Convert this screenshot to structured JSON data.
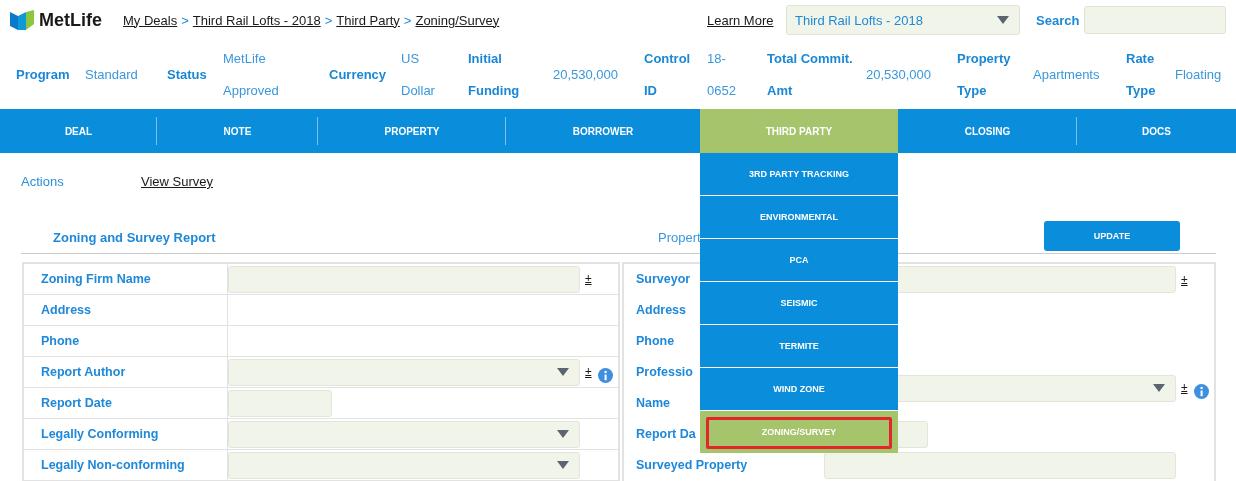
{
  "header": {
    "logo": "MetLife",
    "breadcrumb": [
      "My Deals",
      "Third Rail Lofts - 2018",
      "Third Party",
      "Zoning/Survey"
    ],
    "breadcrumb_separator": ">",
    "learn_more": "Learn More",
    "deal_select": "Third Rail Lofts - 2018",
    "search_label": "Search"
  },
  "summary": [
    {
      "label": "Program",
      "value": "Standard"
    },
    {
      "label": "Status",
      "value": "MetLife Approved"
    },
    {
      "label": "Currency",
      "value": "US Dollar"
    },
    {
      "label": "Initial Funding",
      "value": "20,530,000"
    },
    {
      "label": "Control ID",
      "value": "18-0652"
    },
    {
      "label": "Total Commit. Amt",
      "value": "20,530,000"
    },
    {
      "label": "Property Type",
      "value": "Apartments"
    },
    {
      "label": "Rate Type",
      "value": "Floating"
    }
  ],
  "nav_tabs": [
    {
      "label": "DEAL",
      "selected": false
    },
    {
      "label": "NOTE",
      "selected": false
    },
    {
      "label": "PROPERTY",
      "selected": false
    },
    {
      "label": "BORROWER",
      "selected": false
    },
    {
      "label": "THIRD PARTY",
      "selected": true
    },
    {
      "label": "CLOSING",
      "selected": false
    },
    {
      "label": "DOCS",
      "selected": false
    }
  ],
  "dropdown_menu": [
    {
      "label": "3RD PARTY TRACKING",
      "selected": false,
      "highlighted": false
    },
    {
      "label": "ENVIRONMENTAL",
      "selected": false,
      "highlighted": false
    },
    {
      "label": "PCA",
      "selected": false,
      "highlighted": false
    },
    {
      "label": "SEISMIC",
      "selected": false,
      "highlighted": false
    },
    {
      "label": "TERMITE",
      "selected": false,
      "highlighted": false
    },
    {
      "label": "WIND ZONE",
      "selected": false,
      "highlighted": false
    },
    {
      "label": "ZONING/SURVEY",
      "selected": true,
      "highlighted": true
    }
  ],
  "actions": {
    "label": "Actions",
    "link": "View Survey"
  },
  "section": {
    "title": "Zoning and Survey Report",
    "subtitle": "Propert",
    "button": "UPDATE"
  },
  "left_form": [
    {
      "label": "Zoning Firm Name",
      "kind": "text",
      "plus_minus": true,
      "info": false
    },
    {
      "label": "Address",
      "kind": "none",
      "plus_minus": false,
      "info": false
    },
    {
      "label": "Phone",
      "kind": "none",
      "plus_minus": false,
      "info": false
    },
    {
      "label": "Report Author",
      "kind": "select",
      "plus_minus": true,
      "info": true
    },
    {
      "label": "Report Date",
      "kind": "date",
      "plus_minus": false,
      "info": false
    },
    {
      "label": "Legally Conforming",
      "kind": "select",
      "plus_minus": false,
      "info": false
    },
    {
      "label": "Legally Non-conforming",
      "kind": "select",
      "plus_minus": false,
      "info": false
    }
  ],
  "right_form": [
    {
      "label_lines": [
        "Surveyor"
      ],
      "kind": "text",
      "plus_minus": true,
      "info": false
    },
    {
      "label_lines": [
        "Address"
      ],
      "kind": "none",
      "plus_minus": false,
      "info": false
    },
    {
      "label_lines": [
        "Phone"
      ],
      "kind": "none",
      "plus_minus": false,
      "info": false
    },
    {
      "label_lines": [
        "Professio",
        "Name"
      ],
      "kind": "select",
      "plus_minus": true,
      "info": true
    },
    {
      "label_lines": [
        "Report Da"
      ],
      "kind": "date",
      "plus_minus": false,
      "info": false
    },
    {
      "label_lines": [
        "Surveyed Property"
      ],
      "kind": "text",
      "plus_minus": false,
      "info": false
    }
  ],
  "plus_minus_symbol": "±"
}
